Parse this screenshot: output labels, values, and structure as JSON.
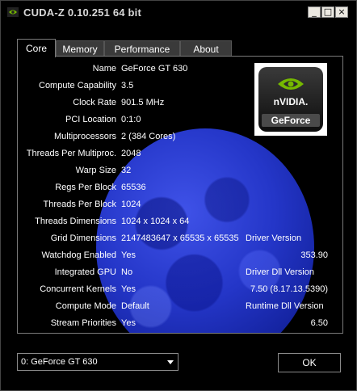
{
  "window": {
    "title": "CUDA-Z 0.10.251 64 bit",
    "controls": {
      "minimize": "_",
      "maximize": "□",
      "close": "×"
    }
  },
  "tabs": [
    {
      "label": "Core",
      "active": true
    },
    {
      "label": "Memory",
      "active": false
    },
    {
      "label": "Performance",
      "active": false
    },
    {
      "label": "About",
      "active": false
    }
  ],
  "logo": {
    "brand": "nVIDIA.",
    "product": "GeForce",
    "accent_color": "#76b900"
  },
  "core": {
    "name": {
      "label": "Name",
      "value": "GeForce GT 630"
    },
    "compute_capability": {
      "label": "Compute Capability",
      "value": "3.5"
    },
    "clock_rate": {
      "label": "Clock Rate",
      "value": "901.5 MHz"
    },
    "pci_location": {
      "label": "PCI Location",
      "value": "0:1:0"
    },
    "multiprocessors": {
      "label": "Multiprocessors",
      "value": "2 (384 Cores)"
    },
    "threads_per_mp": {
      "label": "Threads Per Multiproc.",
      "value": "2048"
    },
    "warp_size": {
      "label": "Warp Size",
      "value": "32"
    },
    "regs_per_block": {
      "label": "Regs Per Block",
      "value": "65536"
    },
    "threads_per_block": {
      "label": "Threads Per Block",
      "value": "1024"
    },
    "threads_dimensions": {
      "label": "Threads Dimensions",
      "value": "1024 x 1024 x 64"
    },
    "grid_dimensions": {
      "label": "Grid Dimensions",
      "value": "2147483647 x 65535 x 65535"
    },
    "watchdog_enabled": {
      "label": "Watchdog Enabled",
      "value": "Yes"
    },
    "integrated_gpu": {
      "label": "Integrated GPU",
      "value": "No"
    },
    "concurrent_kernels": {
      "label": "Concurrent Kernels",
      "value": "Yes"
    },
    "compute_mode": {
      "label": "Compute Mode",
      "value": "Default"
    },
    "stream_priorities": {
      "label": "Stream Priorities",
      "value": "Yes"
    }
  },
  "driver": {
    "version_label": "Driver Version",
    "version_value": "353.90",
    "dll_label": "Driver Dll Version",
    "dll_value": "7.50 (8.17.13.5390)",
    "runtime_label": "Runtime Dll Version",
    "runtime_value": "6.50"
  },
  "device_select": {
    "value": "0: GeForce GT 630"
  },
  "ok_button": {
    "label": "OK"
  }
}
